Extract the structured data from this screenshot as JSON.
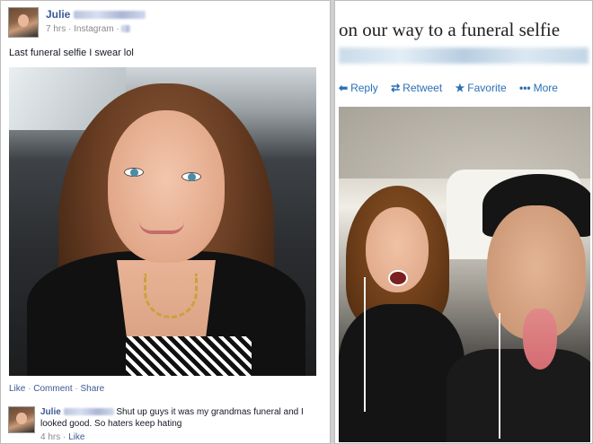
{
  "facebook_post": {
    "author_name": "Julie",
    "meta": "7 hrs · Instagram · ",
    "caption": "Last funeral selfie I swear lol",
    "actions": {
      "like": "Like",
      "dot": " · ",
      "comment": "Comment",
      "share": "Share"
    },
    "comment": {
      "author_name": "Julie",
      "text": "Shut up guys it was my grandmas funeral and I looked good. So haters keep hating",
      "time": "4 hrs",
      "dot": " · ",
      "like": "Like"
    }
  },
  "tweet": {
    "text": "on our way to a funeral selfie",
    "actions": {
      "reply": {
        "icon": "reply-icon",
        "glyph": "⬅",
        "label": "Reply"
      },
      "retweet": {
        "icon": "retweet-icon",
        "glyph": "⇄",
        "label": "Retweet"
      },
      "favorite": {
        "icon": "star-icon",
        "glyph": "★",
        "label": "Favorite"
      },
      "more": {
        "icon": "more-icon",
        "glyph": "•••",
        "label": "More"
      }
    }
  },
  "colors": {
    "facebook_link": "#3b5998",
    "twitter_link": "#2a6fb5"
  }
}
